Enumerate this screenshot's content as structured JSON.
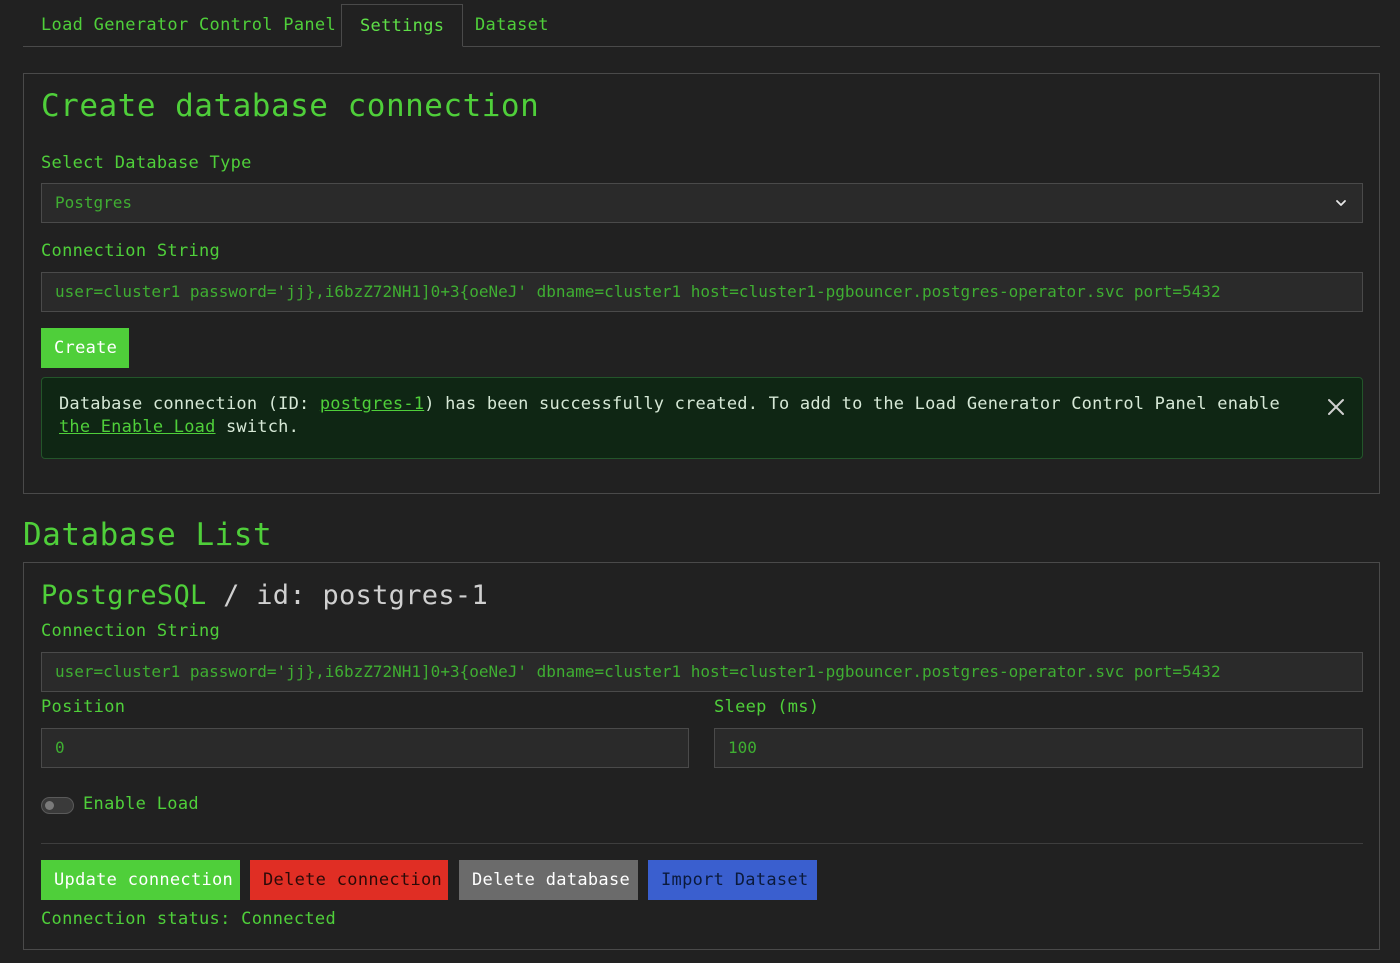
{
  "tabs": [
    {
      "label": "Load Generator Control Panel"
    },
    {
      "label": "Settings"
    },
    {
      "label": "Dataset"
    }
  ],
  "create": {
    "title": "Create database connection",
    "db_type_label": "Select Database Type",
    "db_type_value": "Postgres",
    "conn_label": "Connection String",
    "conn_value": "user=cluster1 password='jj},i6bzZ72NH1]0+3{oeNeJ' dbname=cluster1 host=cluster1-pgbouncer.postgres-operator.svc port=5432",
    "create_button": "Create",
    "alert": {
      "prefix": "Database connection (ID: ",
      "link_id": "postgres-1",
      "middle": ") has been successfully created. To add to the Load Generator Control Panel enable ",
      "link_switch": "the Enable Load",
      "suffix": " switch."
    }
  },
  "list": {
    "title": "Database List",
    "item": {
      "type_label": "PostgreSQL",
      "id_label": " / id: postgres-1",
      "conn_label": "Connection String",
      "conn_value": "user=cluster1 password='jj},i6bzZ72NH1]0+3{oeNeJ' dbname=cluster1 host=cluster1-pgbouncer.postgres-operator.svc port=5432",
      "position_label": "Position",
      "position_value": "0",
      "sleep_label": "Sleep (ms)",
      "sleep_value": "100",
      "enable_load_label": "Enable Load",
      "enable_load_on": false,
      "buttons": {
        "update": "Update connection",
        "delete_conn": "Delete connection",
        "delete_db": "Delete database",
        "import": "Import Dataset"
      },
      "status": "Connection status: Connected"
    }
  },
  "colors": {
    "accent": "#4fcf3a",
    "background": "#212121",
    "danger": "#e02e24",
    "neutral": "#6b6b6b",
    "info": "#3a5fcf"
  }
}
